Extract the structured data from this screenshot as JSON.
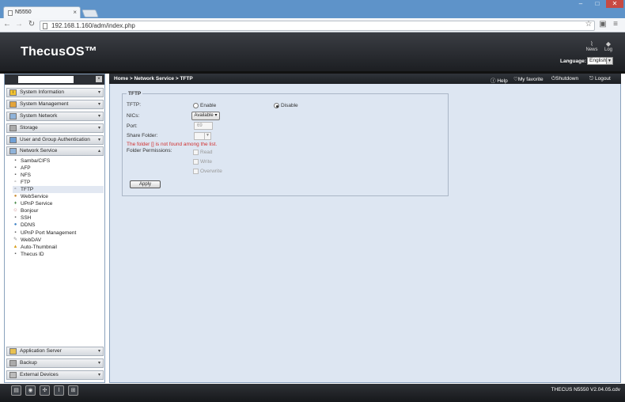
{
  "browser": {
    "tab_title": "N5550",
    "url": "192.168.1.160/adm/index.php",
    "win_min": "‒",
    "win_max": "□",
    "win_close": "✕"
  },
  "header": {
    "logo": "ThecusOS™",
    "news_label": "News",
    "log_label": "Log",
    "language_label": "Language:",
    "language_value": "English"
  },
  "sidebar": {
    "categories_top": [
      {
        "label": "System Information",
        "icon": "info-icon"
      },
      {
        "label": "System Management",
        "icon": "tools-icon"
      },
      {
        "label": "System Network",
        "icon": "network-icon"
      },
      {
        "label": "Storage",
        "icon": "storage-icon"
      },
      {
        "label": "User and Group Authentication",
        "icon": "users-icon"
      },
      {
        "label": "Network Service",
        "icon": "network-service-icon"
      }
    ],
    "subitems": [
      {
        "label": "Samba/CIFS"
      },
      {
        "label": "AFP"
      },
      {
        "label": "NFS"
      },
      {
        "label": "FTP"
      },
      {
        "label": "TFTP"
      },
      {
        "label": "WebService"
      },
      {
        "label": "UPnP Service"
      },
      {
        "label": "Bonjour"
      },
      {
        "label": "SSH"
      },
      {
        "label": "DDNS"
      },
      {
        "label": "UPnP Port Management"
      },
      {
        "label": "WebDAV"
      },
      {
        "label": "Auto-Thumbnail"
      },
      {
        "label": "Thecus ID"
      }
    ],
    "selected_subitem": "TFTP",
    "categories_bottom": [
      {
        "label": "Application Server"
      },
      {
        "label": "Backup"
      },
      {
        "label": "External Devices"
      }
    ]
  },
  "toolbar": {
    "breadcrumb": "Home > Network Service > TFTP",
    "help": "Help",
    "favorite": "My favorite",
    "shutdown": "Shutdown",
    "logout": "Logout"
  },
  "form": {
    "legend": "TFTP",
    "tftp_label": "TFTP:",
    "enable_label": "Enable",
    "disable_label": "Disable",
    "selected": "Disable",
    "nics_label": "NICs:",
    "nics_value": "Available",
    "port_label": "Port:",
    "port_value": "69",
    "share_folder_label": "Share Folder:",
    "error": "The folder [] is not found among the list.",
    "folder_permissions_label": "Folder Permissions:",
    "perm_read": "Read",
    "perm_write": "Write",
    "perm_overwrite": "Overwrite",
    "apply": "Apply"
  },
  "footer": {
    "version": "THECUS N5550 V2.04.05.cdv"
  },
  "colors": {
    "header_bg": "#2a2d32",
    "content_bg": "#dde6f2",
    "error": "#d03030",
    "browser_frame": "#5e93c9"
  }
}
